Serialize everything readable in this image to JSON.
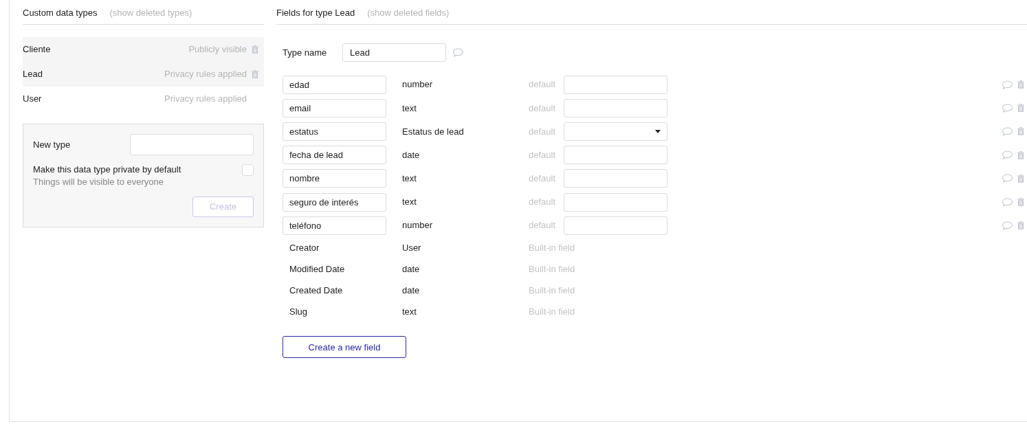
{
  "types_panel": {
    "title": "Custom data types",
    "link": "(show deleted types)",
    "types": [
      {
        "name": "Cliente",
        "privacy": "Publicly visible",
        "highlighted": true,
        "deletable": true
      },
      {
        "name": "Lead",
        "privacy": "Privacy rules applied",
        "highlighted": true,
        "deletable": true
      },
      {
        "name": "User",
        "privacy": "Privacy rules applied",
        "highlighted": false,
        "deletable": false
      }
    ],
    "new_type": {
      "label": "New type",
      "private_label": "Make this data type private by default",
      "private_checked": false,
      "hint": "Things will be visible to everyone",
      "button": "Create",
      "button_disabled": true
    }
  },
  "fields_panel": {
    "title": "Fields for type Lead",
    "link": "(show deleted fields)",
    "type_name_label": "Type name",
    "type_name": "Lead",
    "fields": [
      {
        "kind": "custom",
        "name": "edad",
        "type": "number",
        "default": {
          "label": "default",
          "kind": "input"
        }
      },
      {
        "kind": "custom",
        "name": "email",
        "type": "text",
        "default": {
          "label": "default",
          "kind": "input"
        }
      },
      {
        "kind": "custom",
        "name": "estatus",
        "type": "Estatus de lead",
        "default": {
          "label": "default",
          "kind": "select"
        }
      },
      {
        "kind": "custom",
        "name": "fecha de lead",
        "type": "date",
        "default": {
          "label": "default",
          "kind": "input"
        }
      },
      {
        "kind": "custom",
        "name": "nombre",
        "type": "text",
        "default": {
          "label": "default",
          "kind": "input"
        }
      },
      {
        "kind": "custom",
        "name": "seguro de interés",
        "type": "text",
        "default": {
          "label": "default",
          "kind": "input"
        }
      },
      {
        "kind": "custom",
        "name": "teléfono",
        "type": "number",
        "default": {
          "label": "default",
          "kind": "input"
        }
      },
      {
        "kind": "builtin",
        "name": "Creator",
        "type": "User",
        "note": "Built-in field"
      },
      {
        "kind": "builtin",
        "name": "Modified Date",
        "type": "date",
        "note": "Built-in field"
      },
      {
        "kind": "builtin",
        "name": "Created Date",
        "type": "date",
        "note": "Built-in field"
      },
      {
        "kind": "builtin",
        "name": "Slug",
        "type": "text",
        "note": "Built-in field"
      }
    ],
    "create_button": "Create a new field"
  }
}
